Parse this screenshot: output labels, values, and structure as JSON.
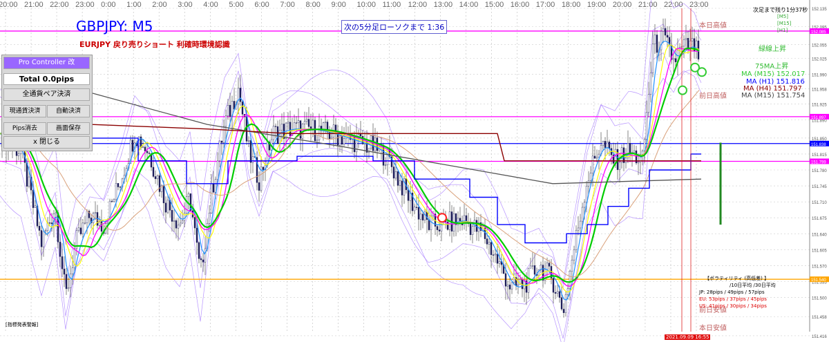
{
  "chart_title": "GBPJPY: M5",
  "strategy_label": "EURJPY 戻り売りショート 利確時環境認識",
  "countdown_label": "次の5分足ローソクまで 1:36",
  "top_right_label": "次足まで残り1分37秒",
  "timeframe_flags": [
    "[M5]",
    "[M15]",
    "[H1]"
  ],
  "controller": {
    "title": "Pro Controller 改",
    "total": "Total   0.0pips",
    "close_all": "全通貨ペア決済",
    "close_current": "現通貨決済",
    "auto_close": "自動決済",
    "clear_pips": "Pips消去",
    "save_screen": "画面保存",
    "close_panel": "x 閉じる"
  },
  "right_labels": {
    "today_high": "本日高値",
    "green_up": "緑線上昇",
    "ma75_up": "75MA上昇",
    "ma_m15_a": "MA (M15) 152.017",
    "ma_h1": "MA (H1) 151.816",
    "ma_h4": "MA (H4) 151.797",
    "ma_m15_b": "MA (M15) 151.754",
    "prev_high": "前日高値",
    "prev_low": "前日安値",
    "today_low": "本日安値"
  },
  "volatility": {
    "title": "【ボラティリティ (高低差) 】",
    "header": "/10日平均 /30日平均",
    "rows": [
      "JP: 28pips / 49pips / 57pips",
      "EU: 53pips / 37pips / 45pips",
      "US: 41pips / 30pips / 34pips"
    ]
  },
  "bottom_left_label": "[指標発表警報]",
  "date_box": "2021.09.09 16:55",
  "colors": {
    "magenta": "#ff00ff",
    "blue": "#0000ff",
    "darkred": "#8b0000",
    "orange": "#ffa500",
    "green": "#00cc00",
    "yellow": "#ffff00",
    "cyan": "#1e90ff",
    "purple": "#9966ff"
  },
  "chart_data": {
    "type": "candlestick",
    "symbol": "GBPJPY",
    "timeframe": "M5",
    "ylim": [
      151.425,
      152.135
    ],
    "y_ticks": [
      152.135,
      152.095,
      152.055,
      152.025,
      151.99,
      151.958,
      151.925,
      151.89,
      151.85,
      151.815,
      151.78,
      151.745,
      151.71,
      151.675,
      151.64,
      151.605,
      151.57,
      151.535,
      151.5,
      151.458,
      151.416
    ],
    "x_tick_labels": [
      "20:00",
      "21:00",
      "22:00",
      "23:00",
      "0:00",
      "1:00",
      "2:00",
      "3:00",
      "4:00",
      "5:00",
      "6:00",
      "7:00",
      "8:00",
      "9:00",
      "10:00",
      "11:00",
      "12:00",
      "13:00",
      "14:00",
      "15:00",
      "16:00",
      "17:00",
      "18:00",
      "19:00",
      "20:00",
      "21:00",
      "22:00",
      "23:00"
    ],
    "horizontal_lines": [
      {
        "name": "本日高値",
        "value": 152.085,
        "color": "#ff00ff"
      },
      {
        "name": "前日高値",
        "value": 151.897,
        "color": "#ff00ff"
      },
      {
        "name": "",
        "value": 151.838,
        "color": "#0000ff"
      },
      {
        "name": "",
        "value": 151.799,
        "color": "#ff00ff"
      },
      {
        "name": "",
        "value": 151.54,
        "color": "#ffa500"
      }
    ],
    "price_path": [
      [
        0,
        151.86
      ],
      [
        30,
        151.82
      ],
      [
        60,
        151.62
      ],
      [
        80,
        151.7
      ],
      [
        95,
        151.5
      ],
      [
        110,
        151.62
      ],
      [
        130,
        151.68
      ],
      [
        150,
        151.66
      ],
      [
        175,
        151.76
      ],
      [
        195,
        151.86
      ],
      [
        215,
        151.82
      ],
      [
        240,
        151.71
      ],
      [
        260,
        151.66
      ],
      [
        275,
        151.72
      ],
      [
        290,
        151.55
      ],
      [
        305,
        151.72
      ],
      [
        325,
        151.88
      ],
      [
        345,
        151.96
      ],
      [
        360,
        151.82
      ],
      [
        375,
        151.76
      ],
      [
        395,
        151.86
      ],
      [
        420,
        151.87
      ],
      [
        450,
        151.87
      ],
      [
        480,
        151.86
      ],
      [
        500,
        151.85
      ],
      [
        520,
        151.84
      ],
      [
        540,
        151.83
      ],
      [
        560,
        151.81
      ],
      [
        580,
        151.75
      ],
      [
        600,
        151.7
      ],
      [
        620,
        151.66
      ],
      [
        640,
        151.66
      ],
      [
        670,
        151.67
      ],
      [
        700,
        151.64
      ],
      [
        720,
        151.58
      ],
      [
        740,
        151.52
      ],
      [
        760,
        151.53
      ],
      [
        780,
        151.57
      ],
      [
        800,
        151.54
      ],
      [
        815,
        151.47
      ],
      [
        830,
        151.6
      ],
      [
        850,
        151.76
      ],
      [
        870,
        151.84
      ],
      [
        890,
        151.8
      ],
      [
        910,
        151.82
      ],
      [
        930,
        151.8
      ],
      [
        945,
        152.05
      ],
      [
        960,
        152.07
      ],
      [
        975,
        152.02
      ],
      [
        990,
        152.05
      ],
      [
        1005,
        152.05
      ],
      [
        1015,
        152.02
      ]
    ]
  }
}
